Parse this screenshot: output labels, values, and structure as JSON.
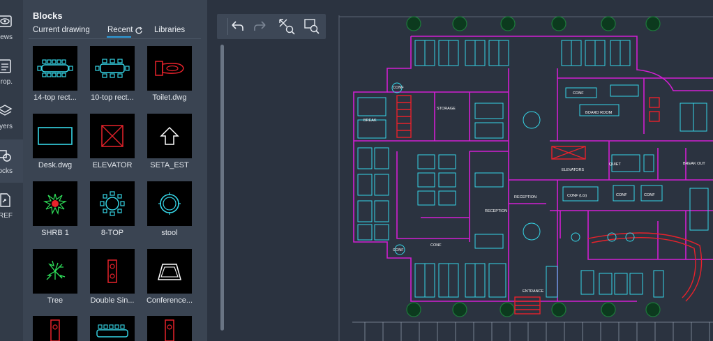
{
  "rail": {
    "items": [
      {
        "label": "ews",
        "icon": "eye-icon"
      },
      {
        "label": "rop.",
        "icon": "properties-icon"
      },
      {
        "label": "yers",
        "icon": "layers-icon"
      },
      {
        "label": "ocks",
        "icon": "blocks-icon"
      },
      {
        "label": "REF",
        "icon": "xref-icon"
      }
    ]
  },
  "panel": {
    "title": "Blocks",
    "tabs": {
      "current": "Current drawing",
      "recent": "Recent",
      "libraries": "Libraries"
    },
    "active_tab": "Recent",
    "blocks": [
      {
        "label": "14-top rect...",
        "icon": "conference-table-14-icon"
      },
      {
        "label": "10-top rect...",
        "icon": "conference-table-10-icon"
      },
      {
        "label": "Toilet.dwg",
        "icon": "toilet-icon"
      },
      {
        "label": "Desk.dwg",
        "icon": "desk-icon"
      },
      {
        "label": "ELEVATOR",
        "icon": "elevator-icon"
      },
      {
        "label": "SETA_EST",
        "icon": "arrow-up-icon"
      },
      {
        "label": "SHRB 1",
        "icon": "shrub-icon"
      },
      {
        "label": "8-TOP",
        "icon": "round-table-icon"
      },
      {
        "label": "stool",
        "icon": "stool-icon"
      },
      {
        "label": "Tree",
        "icon": "tree-icon"
      },
      {
        "label": "Double Sin...",
        "icon": "double-sink-icon"
      },
      {
        "label": "Conference...",
        "icon": "conference-room-icon"
      }
    ]
  },
  "toolbar": {
    "buttons": [
      "undo-icon",
      "redo-icon",
      "zoom-extents-icon",
      "zoom-window-icon"
    ]
  },
  "drawing": {
    "labels": {
      "storage": "STORAGE",
      "break": "BREAK",
      "board_room": "BOARD ROOM",
      "conf": "CONF",
      "conf_lg": "CONF (LG)",
      "elevators": "ELEVATORS",
      "reception": "RECEPTION",
      "entrance": "ENTRANCE",
      "break_out": "BREAK OUT",
      "quiet": "QUIET"
    }
  },
  "colors": {
    "app_bg": "#2b3340",
    "panel_bg": "#3a4452",
    "accent": "#2d9cdb",
    "cad_cyan": "#36d6e7",
    "cad_magenta": "#d21fd2",
    "cad_red": "#e8222b",
    "cad_green": "#2fe05a"
  }
}
